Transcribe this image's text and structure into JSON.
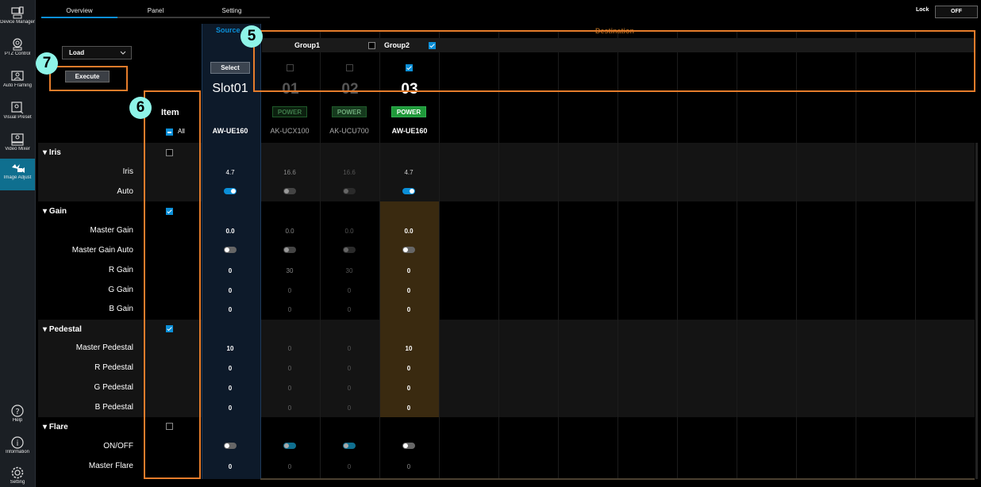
{
  "sidebar": {
    "items": [
      {
        "label": "Device Manager",
        "icon": "device-manager-icon"
      },
      {
        "label": "PTZ Control",
        "icon": "camera-control-icon"
      },
      {
        "label": "Auto Framing",
        "icon": "auto-framing-icon"
      },
      {
        "label": "Visual Preset",
        "icon": "visual-preset-icon"
      },
      {
        "label": "Video Mixer",
        "icon": "video-mixer-icon"
      },
      {
        "label": "Image Adjust",
        "icon": "image-adjust-icon"
      }
    ],
    "bottom": [
      {
        "label": "Help",
        "icon": "help-icon"
      },
      {
        "label": "Information",
        "icon": "info-icon"
      },
      {
        "label": "Setting",
        "icon": "gear-icon"
      }
    ]
  },
  "tabs": [
    "Overview",
    "Panel",
    "Setting"
  ],
  "lock": {
    "label": "Lock",
    "value": "OFF"
  },
  "load": {
    "value": "Load",
    "execute_label": "Execute"
  },
  "badges": {
    "five": "5",
    "six": "6",
    "seven": "7"
  },
  "item_header": {
    "title": "Item",
    "all_label": "All"
  },
  "source": {
    "header": "Source",
    "select_label": "Select",
    "slot": "Slot01",
    "model": "AW-UE160"
  },
  "destination": {
    "header": "Destination",
    "group1": "Group1",
    "group2": "Group2",
    "slots": [
      {
        "num": "01",
        "power": "POWER",
        "model": "AK-UCX100"
      },
      {
        "num": "02",
        "power": "POWER",
        "model": "AK-UCU700"
      },
      {
        "num": "03",
        "power": "POWER",
        "model": "AW-UE160"
      }
    ]
  },
  "sections": {
    "iris": "Iris",
    "gain": "Gain",
    "pedestal": "Pedestal",
    "flare": "Flare"
  },
  "rows": {
    "iris": "Iris",
    "auto": "Auto",
    "master_gain": "Master Gain",
    "master_gain_auto": "Master Gain Auto",
    "r_gain": "R Gain",
    "g_gain": "G Gain",
    "b_gain": "B Gain",
    "master_pedestal": "Master Pedestal",
    "r_pedestal": "R Pedestal",
    "g_pedestal": "G Pedestal",
    "b_pedestal": "B Pedestal",
    "flare_onoff": "ON/OFF",
    "master_flare": "Master Flare"
  },
  "values": {
    "source": {
      "iris": "4.7",
      "master_gain": "0.0",
      "r_gain": "0",
      "g_gain": "0",
      "b_gain": "0",
      "master_pedestal": "10",
      "r_pedestal": "0",
      "g_pedestal": "0",
      "b_pedestal": "0",
      "master_flare": "0"
    },
    "d1": {
      "iris": "16.6",
      "master_gain": "0.0",
      "r_gain": "30",
      "g_gain": "0",
      "b_gain": "0",
      "master_pedestal": "0",
      "r_pedestal": "0",
      "g_pedestal": "0",
      "b_pedestal": "0",
      "master_flare": "0"
    },
    "d2": {
      "iris": "16.6",
      "master_gain": "0.0",
      "r_gain": "30",
      "g_gain": "0",
      "b_gain": "0",
      "master_pedestal": "0",
      "r_pedestal": "0",
      "g_pedestal": "0",
      "b_pedestal": "0",
      "master_flare": "0"
    },
    "d3": {
      "iris": "4.7",
      "master_gain": "0.0",
      "r_gain": "0",
      "g_gain": "0",
      "b_gain": "0",
      "master_pedestal": "10",
      "r_pedestal": "0",
      "g_pedestal": "0",
      "b_pedestal": "0",
      "master_flare": "0"
    }
  },
  "colors": {
    "accent": "#0b8fd8",
    "orange_highlight": "#e57c2b",
    "source_column": "#0d1a2a",
    "selected_dest_column": "#3a2a10",
    "power_on": "#1f9a3a"
  }
}
